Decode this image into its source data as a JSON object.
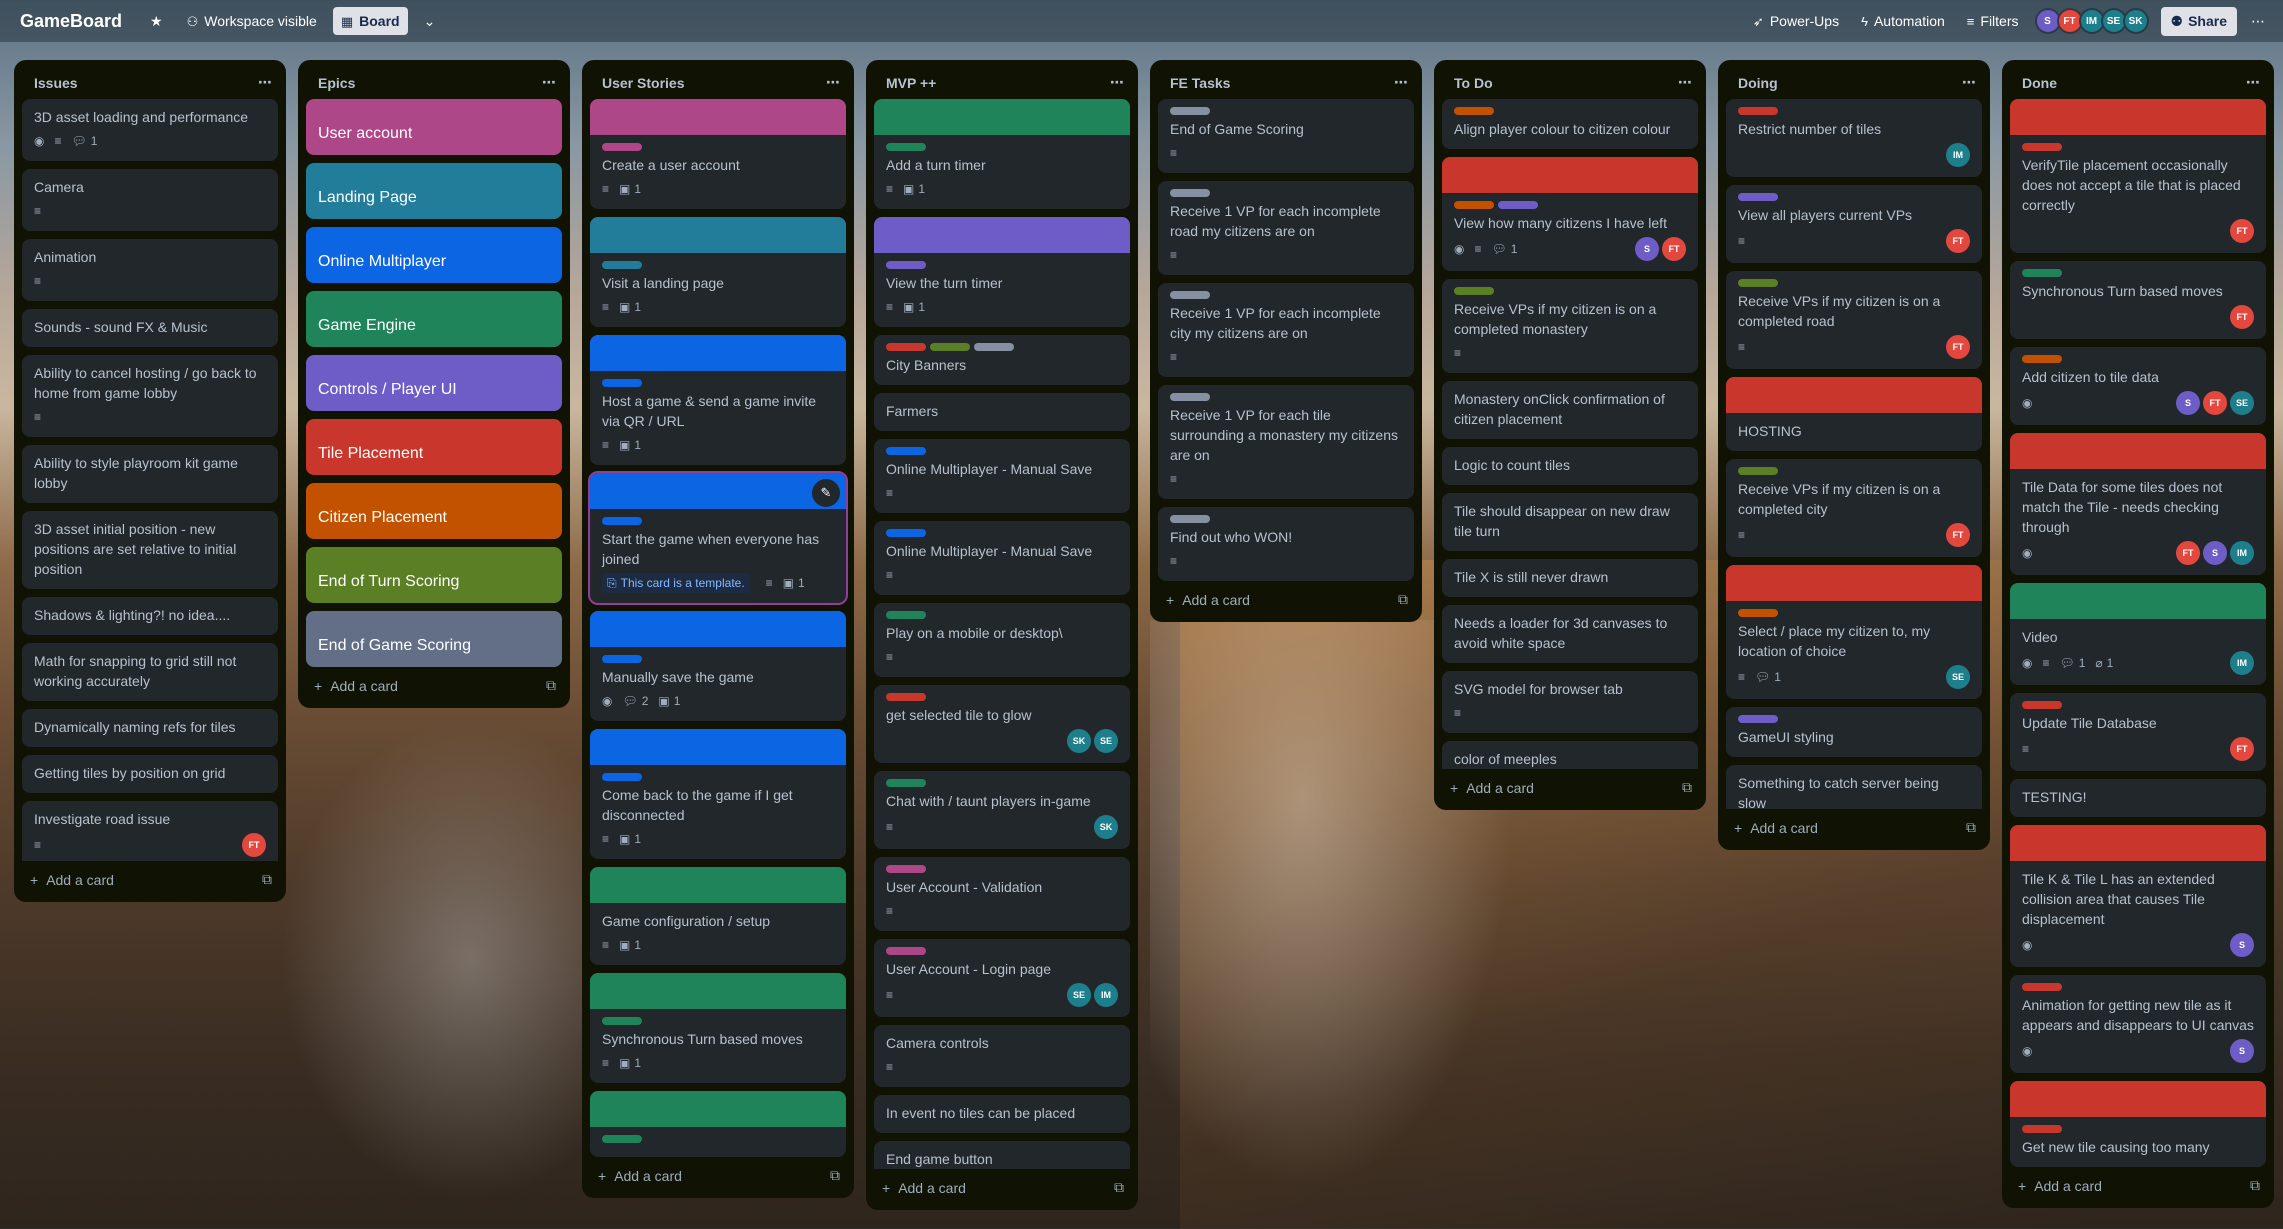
{
  "header": {
    "board_title": "GameBoard",
    "visibility_label": "Workspace visible",
    "view_label": "Board",
    "powerups_label": "Power-Ups",
    "automation_label": "Automation",
    "filters_label": "Filters",
    "share_label": "Share",
    "members": [
      {
        "initials": "S",
        "color": "#6e5dc6"
      },
      {
        "initials": "FT",
        "color": "#e2483d"
      },
      {
        "initials": "IM",
        "color": "#1d7f8c"
      },
      {
        "initials": "SE",
        "color": "#1d7f8c"
      },
      {
        "initials": "SK",
        "color": "#1d7f8c"
      }
    ]
  },
  "add_card_label": "Add a card",
  "template_label": "This card is a template.",
  "colors": {
    "red": "#c9372c",
    "orange": "#c25100",
    "green": "#1f845a",
    "purple": "#6e5dc6",
    "blue": "#0c66e4",
    "teal": "#227d9b",
    "pink": "#ae4787",
    "lime": "#5b7f24",
    "gray": "#8590a2",
    "list_bg": "#101204",
    "card_bg": "#22272b"
  },
  "lists": [
    {
      "title": "Issues",
      "cards": [
        {
          "title": "3D asset loading and performance",
          "watch": true,
          "desc": true,
          "comments": "1"
        },
        {
          "title": "Camera",
          "desc": true
        },
        {
          "title": "Animation",
          "desc": true
        },
        {
          "title": "Sounds - sound FX & Music"
        },
        {
          "title": "Ability to cancel hosting / go back to home from game lobby",
          "desc": true
        },
        {
          "title": "Ability to style playroom kit game lobby"
        },
        {
          "title": "3D asset initial position - new positions are set relative to initial position"
        },
        {
          "title": "Shadows & lighting?! no idea...."
        },
        {
          "title": "Math for snapping to grid still not working accurately"
        },
        {
          "title": "Dynamically naming refs for tiles"
        },
        {
          "title": "Getting tiles by position on grid"
        },
        {
          "title": "Investigate road issue",
          "desc": true,
          "members": [
            "FT"
          ]
        }
      ]
    },
    {
      "title": "Epics",
      "epics": [
        {
          "title": "User account",
          "color": "#ae4787"
        },
        {
          "title": "Landing Page",
          "color": "#227d9b"
        },
        {
          "title": "Online Multiplayer",
          "color": "#0c66e4"
        },
        {
          "title": "Game Engine",
          "color": "#1f845a"
        },
        {
          "title": "Controls / Player UI",
          "color": "#6e5dc6"
        },
        {
          "title": "Tile Placement",
          "color": "#c9372c"
        },
        {
          "title": "Citizen Placement",
          "color": "#c25100"
        },
        {
          "title": "End of Turn Scoring",
          "color": "#5b7f24"
        },
        {
          "title": "End of Game Scoring",
          "color": "#626f86"
        }
      ]
    },
    {
      "title": "User Stories",
      "cards": [
        {
          "title": "Create a user account",
          "cover": "#ae4787",
          "labels": [
            "#ae4787"
          ],
          "desc": true,
          "checklist": "1"
        },
        {
          "title": "Visit a landing page",
          "cover": "#227d9b",
          "labels": [
            "#227d9b"
          ],
          "desc": true,
          "checklist": "1"
        },
        {
          "title": "Host a game & send a game invite via QR / URL",
          "cover": "#0c66e4",
          "labels": [
            "#0c66e4"
          ],
          "desc": true,
          "checklist": "1"
        },
        {
          "title": "Start the game when everyone has joined",
          "cover": "#0c66e4",
          "labels": [
            "#0c66e4"
          ],
          "template": true,
          "desc": true,
          "checklist": "1",
          "selected": true
        },
        {
          "title": "Manually save the game",
          "cover": "#0c66e4",
          "labels": [
            "#0c66e4"
          ],
          "watch": true,
          "comments": "2",
          "checklist": "1"
        },
        {
          "title": "Come back to the game if I get disconnected",
          "cover": "#0c66e4",
          "labels": [
            "#0c66e4"
          ],
          "desc": true,
          "checklist": "1"
        },
        {
          "title": "Game configuration / setup",
          "cover": "#1f845a",
          "desc": true,
          "checklist": "1"
        },
        {
          "title": "Synchronous Turn based moves",
          "cover": "#1f845a",
          "labels": [
            "#1f845a"
          ],
          "desc": true,
          "checklist": "1"
        },
        {
          "title": "",
          "cover": "#1f845a",
          "labels": [
            "#1f845a"
          ]
        }
      ]
    },
    {
      "title": "MVP ++",
      "cards": [
        {
          "title": "Add a turn timer",
          "cover": "#1f845a",
          "labels": [
            "#1f845a"
          ],
          "desc": true,
          "checklist": "1"
        },
        {
          "title": "View the turn timer",
          "cover": "#6e5dc6",
          "labels": [
            "#6e5dc6"
          ],
          "desc": true,
          "checklist": "1"
        },
        {
          "title": "City Banners",
          "labels": [
            "#c9372c",
            "#5b7f24",
            "#8590a2"
          ]
        },
        {
          "title": "Farmers"
        },
        {
          "title": "Online Multiplayer - Manual Save",
          "labels": [
            "#0c66e4"
          ],
          "desc": true
        },
        {
          "title": "Online Multiplayer - Manual Save",
          "labels": [
            "#0c66e4"
          ],
          "desc": true
        },
        {
          "title": "Play on a mobile or desktop\\",
          "labels": [
            "#1f845a"
          ],
          "desc": true
        },
        {
          "title": "get selected tile to glow",
          "labels": [
            "#c9372c"
          ],
          "members": [
            "SK",
            "SE"
          ]
        },
        {
          "title": "Chat with / taunt players in-game",
          "labels": [
            "#1f845a"
          ],
          "desc": true,
          "members": [
            "SK"
          ]
        },
        {
          "title": "User Account - Validation",
          "labels": [
            "#ae4787"
          ],
          "desc": true
        },
        {
          "title": "User Account - Login page",
          "labels": [
            "#ae4787"
          ],
          "desc": true,
          "members": [
            "SE",
            "IM"
          ]
        },
        {
          "title": "Camera controls",
          "desc": true
        },
        {
          "title": "In event no tiles can be placed"
        },
        {
          "title": "End game button"
        }
      ]
    },
    {
      "title": "FE Tasks",
      "cards": [
        {
          "title": "End of Game Scoring",
          "labels": [
            "#8590a2"
          ],
          "desc": true
        },
        {
          "title": "Receive 1 VP for each incomplete road my citizens are on",
          "labels": [
            "#8590a2"
          ],
          "desc": true
        },
        {
          "title": "Receive 1 VP for each incomplete city my citizens are on",
          "labels": [
            "#8590a2"
          ],
          "desc": true
        },
        {
          "title": "Receive 1 VP for each tile surrounding a monastery my citizens are on",
          "labels": [
            "#8590a2"
          ],
          "desc": true
        },
        {
          "title": "Find out who WON!",
          "labels": [
            "#8590a2"
          ],
          "desc": true
        }
      ]
    },
    {
      "title": "To Do",
      "cards": [
        {
          "title": "Align player colour to citizen colour",
          "labels": [
            "#c25100"
          ]
        },
        {
          "title": "View how many citizens I have left",
          "cover": "#c9372c",
          "labels": [
            "#c25100",
            "#6e5dc6"
          ],
          "watch": true,
          "desc": true,
          "comments": "1",
          "members": [
            "S",
            "FT"
          ]
        },
        {
          "title": "Receive VPs if my citizen is on a completed monastery",
          "labels": [
            "#5b7f24"
          ],
          "desc": true
        },
        {
          "title": "Monastery onClick confirmation of citizen placement"
        },
        {
          "title": "Logic to count tiles"
        },
        {
          "title": "Tile should disappear on new draw tile turn"
        },
        {
          "title": "Tile X is still never drawn"
        },
        {
          "title": "Needs a loader for 3d canvases to avoid white space"
        },
        {
          "title": "SVG model for browser tab",
          "desc": true
        },
        {
          "title": "color of meeples"
        }
      ]
    },
    {
      "title": "Doing",
      "cards": [
        {
          "title": "Restrict number of tiles",
          "labels": [
            "#c9372c"
          ],
          "members": [
            "IM"
          ]
        },
        {
          "title": "View all players current VPs",
          "labels": [
            "#6e5dc6"
          ],
          "desc": true,
          "members": [
            "FT"
          ]
        },
        {
          "title": "Receive VPs if my citizen is on a completed road",
          "labels": [
            "#5b7f24"
          ],
          "desc": true,
          "members": [
            "FT"
          ]
        },
        {
          "title": "HOSTING",
          "cover": "#c9372c"
        },
        {
          "title": "Receive VPs if my citizen is on a completed city",
          "labels": [
            "#5b7f24"
          ],
          "desc": true,
          "members": [
            "FT"
          ]
        },
        {
          "title": "Select / place my citizen to, my location of choice",
          "cover": "#c9372c",
          "labels": [
            "#c25100"
          ],
          "desc": true,
          "comments": "1",
          "members": [
            "SE"
          ]
        },
        {
          "title": "GameUI styling",
          "labels": [
            "#6e5dc6"
          ]
        },
        {
          "title": "Something to catch server being slow"
        }
      ]
    },
    {
      "title": "Done",
      "cards": [
        {
          "title": "VerifyTile placement occasionally does not accept a tile that is placed correctly",
          "cover": "#c9372c",
          "labels": [
            "#c9372c"
          ],
          "members": [
            "FT"
          ]
        },
        {
          "title": "Synchronous Turn based moves",
          "labels": [
            "#1f845a"
          ],
          "members": [
            "FT"
          ]
        },
        {
          "title": "Add citizen to tile data",
          "labels": [
            "#c25100"
          ],
          "watch": true,
          "members": [
            "S",
            "FT",
            "SE"
          ]
        },
        {
          "title": "Tile Data for some tiles does not match the Tile - needs checking through",
          "cover": "#c9372c",
          "watch": true,
          "members": [
            "FT",
            "S",
            "IM"
          ]
        },
        {
          "title": "Video",
          "cover": "#1f845a",
          "watch": true,
          "desc": true,
          "comments": "1",
          "attachments": "1",
          "members": [
            "IM"
          ]
        },
        {
          "title": "Update Tile Database",
          "labels": [
            "#c9372c"
          ],
          "desc": true,
          "members": [
            "FT"
          ]
        },
        {
          "title": "TESTING!"
        },
        {
          "title": "Tile K & Tile L has an extended collision area that causes Tile displacement",
          "cover": "#c9372c",
          "watch": true,
          "members": [
            "S"
          ]
        },
        {
          "title": "Animation for getting new tile as it appears and disappears to UI canvas",
          "labels": [
            "#c9372c"
          ],
          "watch": true,
          "members": [
            "S"
          ]
        },
        {
          "title": "Get new tile causing too many",
          "cover": "#c9372c",
          "labels": [
            "#c9372c"
          ]
        }
      ]
    }
  ],
  "member_colors": {
    "S": "#6e5dc6",
    "FT": "#e2483d",
    "IM": "#1d7f8c",
    "SE": "#1d7f8c",
    "SK": "#1d7f8c"
  }
}
